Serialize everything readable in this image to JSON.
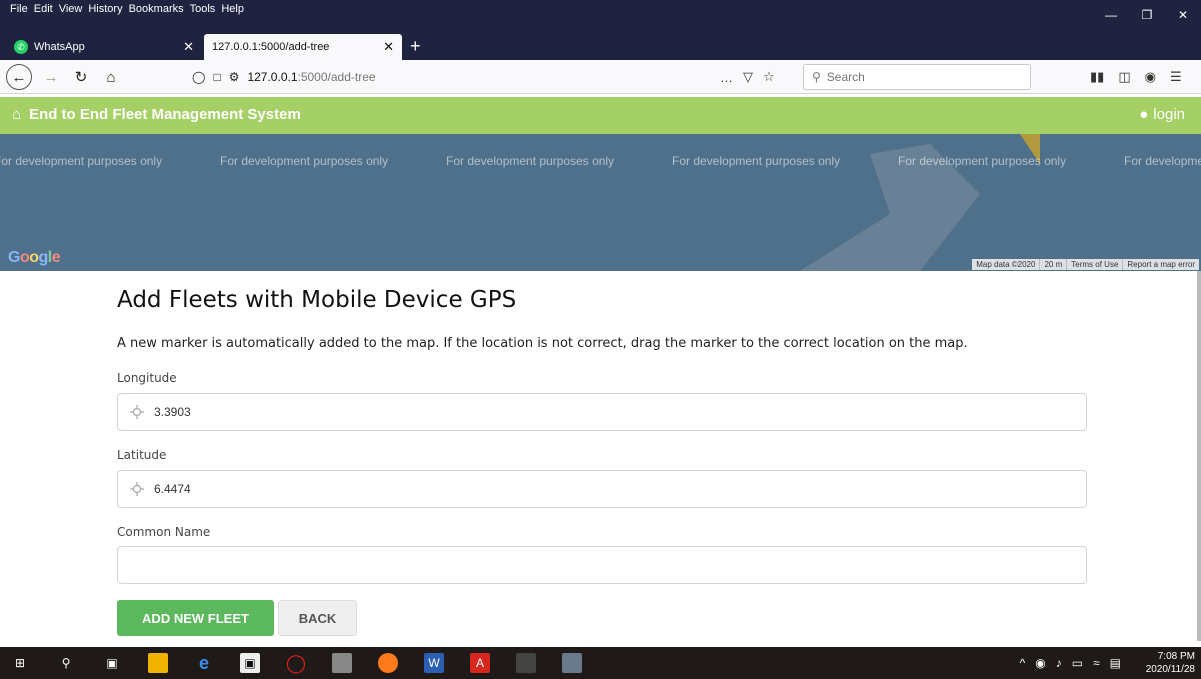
{
  "browser": {
    "menu": [
      "File",
      "Edit",
      "View",
      "History",
      "Bookmarks",
      "Tools",
      "Help"
    ],
    "tabs": [
      {
        "label": "WhatsApp"
      },
      {
        "label": "127.0.0.1:5000/add-tree"
      }
    ],
    "url_host": "127.0.0.1",
    "url_path": ":5000/add-tree",
    "search_placeholder": "Search",
    "url_more": "…"
  },
  "app": {
    "brand": "End to End Fleet Management System",
    "login_label": "login"
  },
  "map": {
    "dev_text": "For development purposes only",
    "google_logo": "Google",
    "attrib_data": "Map data ©2020",
    "attrib_scale": "20 m",
    "attrib_terms": "Terms of Use",
    "attrib_report": "Report a map error"
  },
  "form": {
    "title": "Add Fleets with Mobile Device GPS",
    "description": "A new marker is automatically added to the map. If the location is not correct, drag the marker to the correct location on the map.",
    "longitude_label": "Longitude",
    "longitude_value": "3.3903",
    "latitude_label": "Latitude",
    "latitude_value": "6.4474",
    "common_name_label": "Common Name",
    "common_name_value": "",
    "add_button": "ADD NEW FLEET",
    "back_button": "BACK"
  },
  "taskbar": {
    "time": "7:08 PM",
    "date": "2020/11/28"
  },
  "colors": {
    "header_green": "#a4d065",
    "add_button_green": "#5cb85c",
    "map_blue": "#4f708a"
  }
}
